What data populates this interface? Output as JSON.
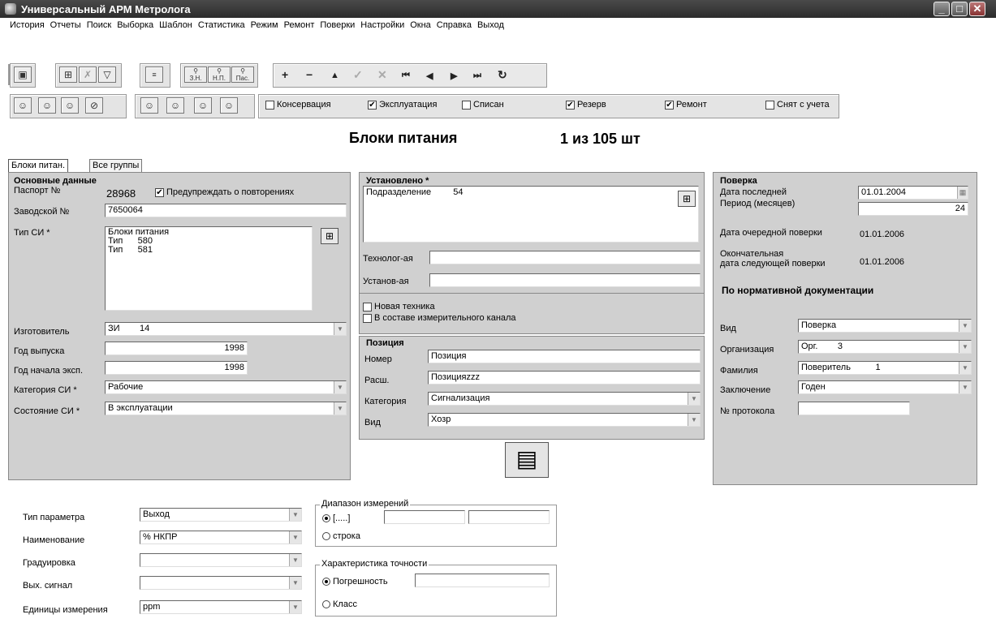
{
  "window": {
    "title": "Универсальный АРМ Метролога"
  },
  "menu": [
    "История",
    "Отчеты",
    "Поиск",
    "Выборка",
    "Шаблон",
    "Статистика",
    "Режим",
    "Ремонт",
    "Поверки",
    "Настройки",
    "Окна",
    "Справка",
    "Выход"
  ],
  "toolbar": {
    "search_zn": "З.Н.",
    "search_np": "Н.П.",
    "search_pas": "Пас.",
    "status_filters": [
      {
        "label": "Консервация",
        "checked": false
      },
      {
        "label": "Эксплуатация",
        "checked": true
      },
      {
        "label": "Списан",
        "checked": false
      },
      {
        "label": "Резерв",
        "checked": true
      },
      {
        "label": "Ремонт",
        "checked": true
      },
      {
        "label": "Снят с учета",
        "checked": false
      }
    ]
  },
  "header": {
    "title": "Блоки питания",
    "count": "1 из 105 шт"
  },
  "tabs": [
    "Блоки питан.",
    "Все группы"
  ],
  "basic": {
    "group_title": "Основные данные",
    "passport_label": "Паспорт №",
    "passport_value": "28968",
    "warn_repeat_label": "Предупреждать о повторениях",
    "factory_label": "Заводской №",
    "factory_value": "7650064",
    "type_label": "Тип СИ *",
    "type_value": "Блоки питания\nТип      580\nТип      581",
    "maker_label": "Изготовитель",
    "maker_value": "ЗИ        14",
    "year_label": "Год выпуска",
    "year_value": "1998",
    "start_label": "Год начала эксп.",
    "start_value": "1998",
    "category_label": "Категория СИ *",
    "category_value": "Рабочие",
    "state_label": "Состояние СИ *",
    "state_value": "В эксплуатации"
  },
  "installed": {
    "group_title": "Установлено *",
    "division_label": "Подразделение",
    "division_value": "54",
    "techn_label": "Технолог-ая",
    "techn_value": "",
    "inst_label": "Установ-ая",
    "inst_value": "",
    "new_tech_label": "Новая техника",
    "channel_label": "В составе измерительного канала"
  },
  "position": {
    "group_title": "Позиция",
    "number_label": "Номер",
    "number_value": "Позиция",
    "rasch_label": "Расш.",
    "rasch_value": "Позицияzzz",
    "category_label": "Категория",
    "category_value": "Сигнализация",
    "kind_label": "Вид",
    "kind_value": "Хозр"
  },
  "verification": {
    "group_title": "Поверка",
    "last_label": "Дата последней",
    "last_value": "01.01.2004",
    "period_label": "Период (месяцев)",
    "period_value": "24",
    "next_label": "Дата очередной поверки",
    "next_value": "01.01.2006",
    "final_label_1": "Окончательная",
    "final_label_2": "дата следующей поверки",
    "final_value": "01.01.2006",
    "norm_title": "По нормативной документации",
    "kind_label": "Вид",
    "kind_value": "Поверка",
    "org_label": "Организация",
    "org_value": "Орг.        3",
    "surname_label": "Фамилия",
    "surname_value": "Поверитель          1",
    "conclusion_label": "Заключение",
    "conclusion_value": "Годен",
    "protocol_label": "№ протокола",
    "protocol_value": ""
  },
  "params": {
    "param_type_label": "Тип параметра",
    "param_type_value": "Выход",
    "name_label": "Наименование",
    "name_value": "% НКПР",
    "grad_label": "Градуировка",
    "grad_value": "",
    "signal_label": "Вых. сигнал",
    "signal_value": "",
    "units_label": "Единицы измерения",
    "units_value": "ppm",
    "range_title": "Диапазон измерений",
    "range_opt1": "[.....]",
    "range_opt2": "строка",
    "accuracy_title": "Характеристика точности",
    "acc_opt1": "Погрешность",
    "acc_opt2": "Класс"
  }
}
